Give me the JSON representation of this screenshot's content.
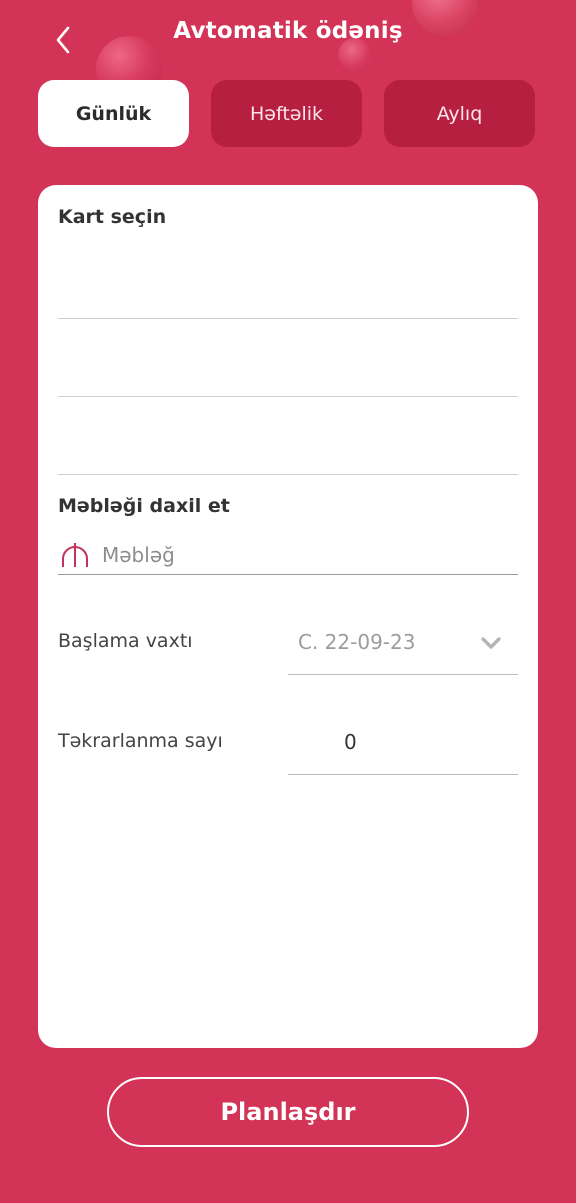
{
  "header": {
    "title": "Avtomatik ödəniş",
    "back_icon": "chevron-left-icon"
  },
  "tabs": [
    {
      "label": "Günlük",
      "selected": true
    },
    {
      "label": "Həftəlik",
      "selected": false
    },
    {
      "label": "Aylıq",
      "selected": false
    }
  ],
  "form": {
    "card_section_label": "Kart seçin",
    "amount_section_label": "Məbləği daxil et",
    "amount_placeholder": "Məbləğ",
    "amount_value": "",
    "currency_icon": "manat-icon",
    "start_time_label": "Başlama vaxtı",
    "start_time_value": "C. 22-09-23",
    "start_time_icon": "chevron-down-icon",
    "repeat_count_label": "Təkrarlanma sayı",
    "repeat_count_value": "0"
  },
  "actions": {
    "schedule_label": "Planlaşdır"
  },
  "colors": {
    "background": "#d33356",
    "tab_inactive": "#b71f41",
    "accent": "#c0335a"
  }
}
